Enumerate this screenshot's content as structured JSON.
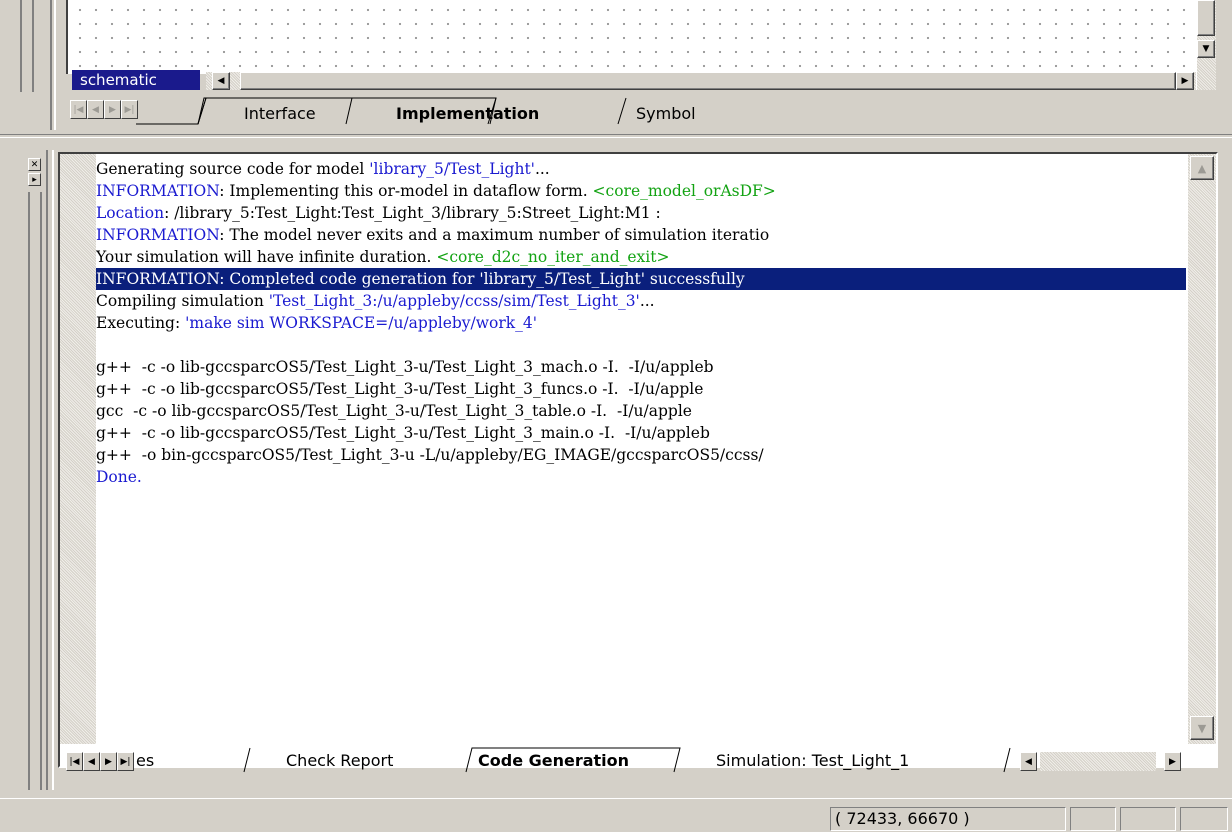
{
  "top": {
    "schematic_label": "schematic",
    "tabs": [
      {
        "label": "Interface",
        "active": false
      },
      {
        "label": "Implementation",
        "active": true
      },
      {
        "label": "Symbol",
        "active": false
      }
    ]
  },
  "log": {
    "lines": [
      {
        "parts": [
          {
            "t": "Generating source code for model "
          },
          {
            "t": "'library_5/Test_Light'",
            "c": "blue"
          },
          {
            "t": "..."
          }
        ]
      },
      {
        "parts": [
          {
            "t": "INFORMATION",
            "c": "blue"
          },
          {
            "t": ": Implementing this or-model in dataflow form. "
          },
          {
            "t": "<core_model_orAsDF>",
            "c": "green"
          }
        ]
      },
      {
        "parts": [
          {
            "t": "Location",
            "c": "blue"
          },
          {
            "t": ": /library_5:Test_Light:Test_Light_3/library_5:Street_Light:M1 :"
          }
        ]
      },
      {
        "parts": [
          {
            "t": "INFORMATION",
            "c": "blue"
          },
          {
            "t": ": The model never exits and a maximum number of simulation iteratio"
          }
        ]
      },
      {
        "parts": [
          {
            "t": "Your simulation will have infinite duration. "
          },
          {
            "t": "<core_d2c_no_iter_and_exit>",
            "c": "green"
          }
        ]
      },
      {
        "highlight": true,
        "parts": [
          {
            "t": "INFORMATION: Completed code generation for 'library_5/Test_Light' successfully"
          }
        ]
      },
      {
        "parts": [
          {
            "t": "Compiling simulation "
          },
          {
            "t": "'Test_Light_3:/u/appleby/ccss/sim/Test_Light_3'",
            "c": "blue"
          },
          {
            "t": "..."
          }
        ]
      },
      {
        "parts": [
          {
            "t": "Executing: "
          },
          {
            "t": "'make sim WORKSPACE=/u/appleby/work_4'",
            "c": "blue"
          }
        ]
      },
      {
        "parts": [
          {
            "t": ""
          }
        ]
      },
      {
        "parts": [
          {
            "t": "g++  -c -o lib-gccsparcOS5/Test_Light_3-u/Test_Light_3_mach.o -I.  -I/u/appleb"
          }
        ]
      },
      {
        "parts": [
          {
            "t": "g++  -c -o lib-gccsparcOS5/Test_Light_3-u/Test_Light_3_funcs.o -I.  -I/u/apple"
          }
        ]
      },
      {
        "parts": [
          {
            "t": "gcc  -c -o lib-gccsparcOS5/Test_Light_3-u/Test_Light_3_table.o -I.  -I/u/apple"
          }
        ]
      },
      {
        "parts": [
          {
            "t": "g++  -c -o lib-gccsparcOS5/Test_Light_3-u/Test_Light_3_main.o -I.  -I/u/appleb"
          }
        ]
      },
      {
        "parts": [
          {
            "t": "g++  -o bin-gccsparcOS5/Test_Light_3-u -L/u/appleby/EG_IMAGE/gccsparcOS5/ccss/"
          }
        ]
      },
      {
        "parts": [
          {
            "t": "Done.",
            "c": "blue"
          }
        ]
      }
    ]
  },
  "bottom": {
    "tabs": [
      {
        "label": "es",
        "active": false
      },
      {
        "label": "Check Report",
        "active": false
      },
      {
        "label": "Code Generation",
        "active": true
      },
      {
        "label": "Simulation: Test_Light_1",
        "active": false
      }
    ]
  },
  "status": {
    "coordinates": "( 72433, 66670 )"
  },
  "icons": {
    "nav_first": "first-tab-icon",
    "nav_prev": "prev-tab-icon",
    "nav_next": "next-tab-icon",
    "nav_last": "last-tab-icon",
    "close": "close-icon",
    "detach": "detach-icon"
  },
  "colors": {
    "highlight": "#0a1f7c",
    "info_blue": "#1a1ad0",
    "tag_green": "#13a313",
    "schematic_tab": "#1a1a8c"
  }
}
